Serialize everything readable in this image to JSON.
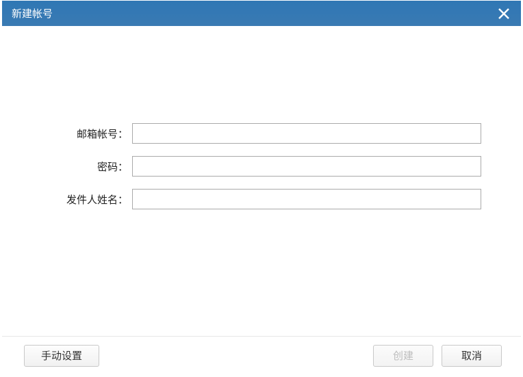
{
  "dialog": {
    "title": "新建帐号",
    "close_icon_name": "close-icon"
  },
  "form": {
    "email": {
      "label": "邮箱帐号：",
      "value": ""
    },
    "password": {
      "label": "密码：",
      "value": ""
    },
    "sender_name": {
      "label": "发件人姓名：",
      "value": ""
    }
  },
  "buttons": {
    "manual_setup": "手动设置",
    "create": "创建",
    "cancel": "取消"
  }
}
